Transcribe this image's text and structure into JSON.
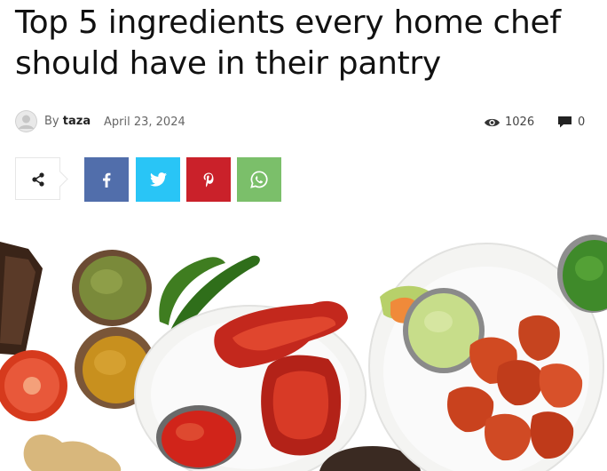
{
  "article": {
    "title": "Top 5 ingredients every home chef should have in their pantry",
    "by_label": "By",
    "author": "taza",
    "date": "April 23, 2024",
    "views": "1026",
    "comments": "0"
  },
  "share": {
    "icons": [
      "share-icon",
      "facebook-icon",
      "twitter-icon",
      "pinterest-icon",
      "whatsapp-icon"
    ],
    "colors": {
      "facebook": "#516eab",
      "twitter": "#29c5f6",
      "pinterest": "#ca212a",
      "whatsapp": "#7bbf6a"
    }
  },
  "hero": {
    "icon": "food-platter-image"
  }
}
